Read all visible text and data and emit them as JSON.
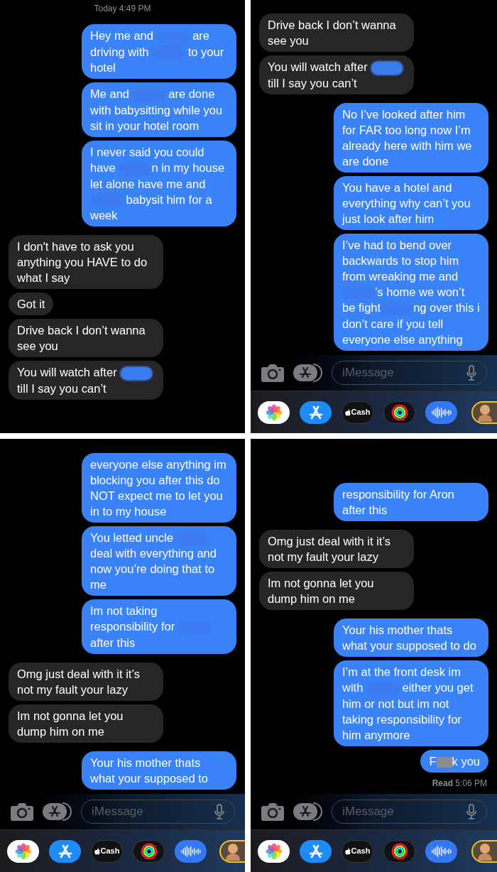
{
  "panels": [
    {
      "timestamp": "Today 4:49 PM",
      "messages": [
        {
          "sent": true,
          "parts": [
            "Hey me and ",
            {
              "kind": "redaction"
            },
            " are driving with ",
            {
              "kind": "redaction"
            },
            " to your hotel"
          ]
        },
        {
          "sent": true,
          "parts": [
            "Me and ",
            {
              "kind": "redaction"
            },
            " are done with babysitting while you sit in your hotel room"
          ]
        },
        {
          "sent": true,
          "parts": [
            "I never said you could have ",
            {
              "kind": "redaction"
            },
            "n in my house let alone have me and ",
            {
              "kind": "redaction"
            },
            " babysit him for a week"
          ]
        },
        {
          "sent": false,
          "parts": [
            "I don't have to ask you anything you HAVE to do what I say"
          ]
        },
        {
          "sent": false,
          "parts": [
            "Got it"
          ]
        },
        {
          "sent": false,
          "parts": [
            "Drive back I don’t wanna see you"
          ]
        },
        {
          "sent": false,
          "parts": [
            "You will watch after ",
            {
              "kind": "redaction"
            },
            " till I say you can’t"
          ]
        }
      ]
    },
    {
      "messages": [
        {
          "sent": false,
          "parts": [
            "Drive back I don’t wanna see you"
          ]
        },
        {
          "sent": false,
          "parts": [
            "You will watch after ",
            {
              "kind": "redaction"
            },
            " till I say you can’t"
          ]
        },
        {
          "sent": true,
          "parts": [
            "No I’ve looked after him for FAR too long now I’m already here with him we are done"
          ]
        },
        {
          "sent": true,
          "parts": [
            "You have a hotel and everything why can’t you just look after him"
          ]
        },
        {
          "sent": true,
          "parts": [
            "I’ve had to bend over backwards to stop him from wreaking me and ",
            {
              "kind": "redaction"
            },
            "’s home we won’t be fight",
            {
              "kind": "redaction"
            },
            "ng over this i don’t care if you tell everyone else anything"
          ]
        }
      ],
      "composer": {
        "placeholder": "iMessage"
      },
      "apps": [
        {
          "kind": "photos"
        },
        {
          "kind": "appstore"
        },
        {
          "kind": "cash",
          "label": "Cash"
        },
        {
          "kind": "activity"
        },
        {
          "kind": "audio"
        },
        {
          "kind": "memoji"
        }
      ]
    },
    {
      "messages": [
        {
          "sent": true,
          "parts": [
            "everyone else anything im blocking you after this do NOT expect me to let you in to my house"
          ]
        },
        {
          "sent": true,
          "parts": [
            "You letted uncle ",
            {
              "kind": "redaction"
            },
            " deal with everything and now you’re doing that to me"
          ]
        },
        {
          "sent": true,
          "parts": [
            "Im not taking responsibility for ",
            {
              "kind": "redaction"
            },
            " after this"
          ]
        },
        {
          "sent": false,
          "parts": [
            "Omg just deal with it it’s not my fault your lazy"
          ]
        },
        {
          "sent": false,
          "parts": [
            "Im not gonna let you dump him on me"
          ]
        },
        {
          "sent": true,
          "parts": [
            "Your his mother thats what your supposed to"
          ]
        }
      ],
      "composer": {
        "placeholder": "iMessage"
      },
      "apps": [
        {
          "kind": "photos"
        },
        {
          "kind": "appstore"
        },
        {
          "kind": "cash",
          "label": "Cash"
        },
        {
          "kind": "activity"
        },
        {
          "kind": "audio"
        },
        {
          "kind": "memoji"
        }
      ]
    },
    {
      "messages": [
        {
          "sent": true,
          "parts": [
            "responsibility for Aron after this"
          ]
        },
        {
          "sent": false,
          "parts": [
            "Omg just deal with it it’s not my fault your lazy"
          ]
        },
        {
          "sent": false,
          "parts": [
            "Im not gonna let you dump him on me"
          ]
        },
        {
          "sent": true,
          "parts": [
            "Your his mother thats what your supposed to do"
          ]
        },
        {
          "sent": true,
          "parts": [
            "I’m at the front desk im with ",
            {
              "kind": "redaction"
            },
            " either you get him or not but im not taking responsibility for him anymore"
          ]
        },
        {
          "sent": true,
          "parts": [
            "F",
            {
              "kind": "censor"
            },
            "k you"
          ]
        }
      ],
      "read_receipt": "**Read** 5:06 PM",
      "composer": {
        "placeholder": "iMessage"
      },
      "apps": [
        {
          "kind": "photos"
        },
        {
          "kind": "appstore"
        },
        {
          "kind": "cash",
          "label": "Cash"
        },
        {
          "kind": "activity"
        },
        {
          "kind": "audio"
        },
        {
          "kind": "memoji"
        }
      ]
    }
  ]
}
